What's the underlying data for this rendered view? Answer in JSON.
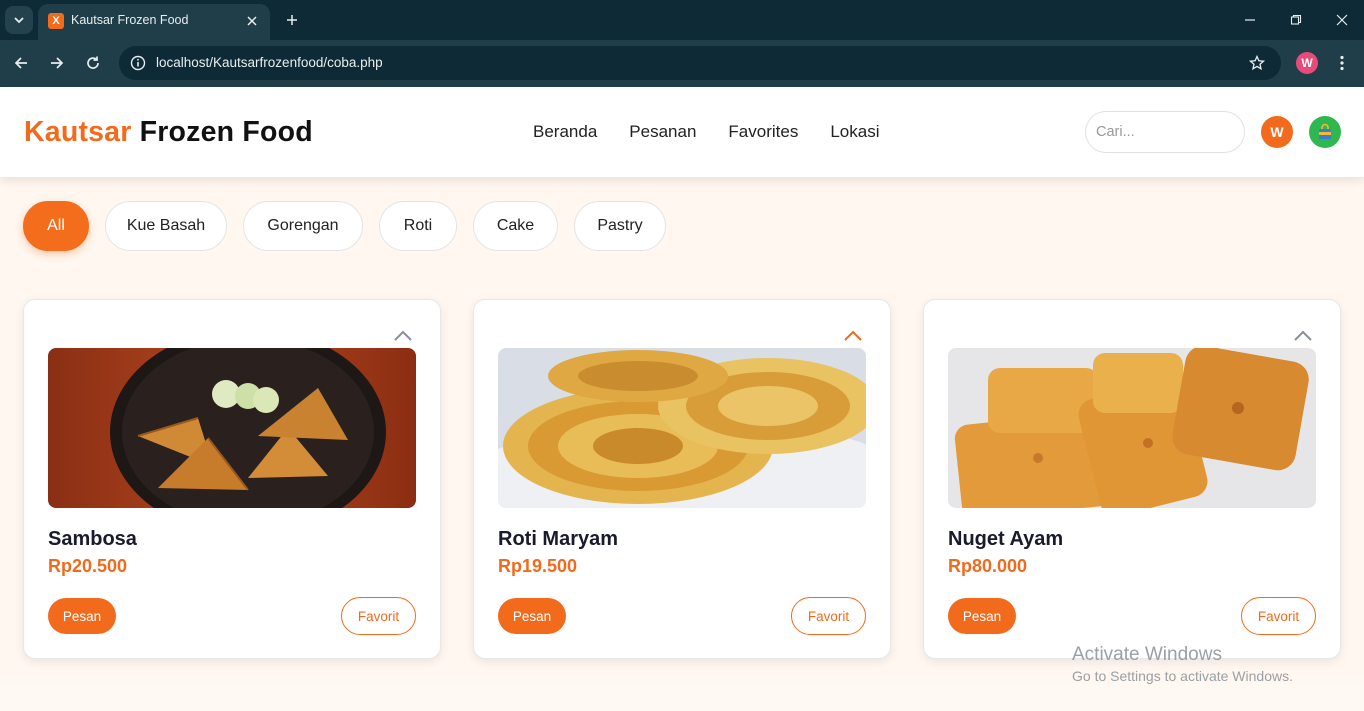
{
  "browser": {
    "tab_title": "Kautsar Frozen Food",
    "favicon_letter": "X",
    "url": "localhost/Kautsarfrozenfood/coba.php",
    "profile_letter": "W"
  },
  "header": {
    "logo_accent": "Kautsar",
    "logo_rest": " Frozen Food",
    "nav": [
      "Beranda",
      "Pesanan",
      "Favorites",
      "Lokasi"
    ],
    "search_placeholder": "Cari...",
    "user_initial": "W",
    "accent_color": "#f26b1d"
  },
  "filters": {
    "items": [
      "All",
      "Kue Basah",
      "Gorengan",
      "Roti",
      "Cake",
      "Pastry"
    ],
    "active": "All"
  },
  "products": [
    {
      "name": "Sambosa",
      "price": "Rp20.500",
      "order_label": "Pesan",
      "favorite_label": "Favorit",
      "expanded_highlight": false
    },
    {
      "name": "Roti Maryam",
      "price": "Rp19.500",
      "order_label": "Pesan",
      "favorite_label": "Favorit",
      "expanded_highlight": true
    },
    {
      "name": "Nuget Ayam",
      "price": "Rp80.000",
      "order_label": "Pesan",
      "favorite_label": "Favorit",
      "expanded_highlight": false
    }
  ],
  "watermark": {
    "line1": "Activate Windows",
    "line2": "Go to Settings to activate Windows."
  }
}
